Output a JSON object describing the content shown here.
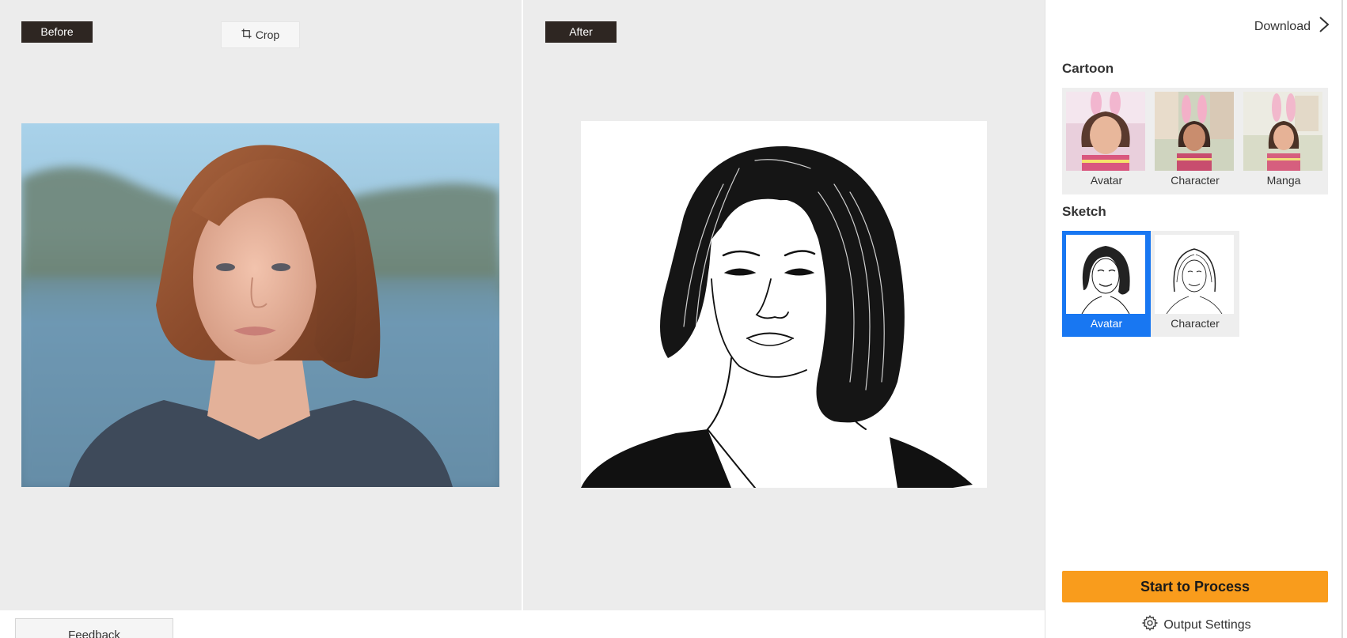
{
  "before_pane": {
    "tag": "Before",
    "crop_label": "Crop"
  },
  "after_pane": {
    "tag": "After"
  },
  "sidebar": {
    "download_label": "Download",
    "cartoon": {
      "title": "Cartoon",
      "items": [
        {
          "label": "Avatar"
        },
        {
          "label": "Character"
        },
        {
          "label": "Manga"
        }
      ]
    },
    "sketch": {
      "title": "Sketch",
      "items": [
        {
          "label": "Avatar",
          "selected": true
        },
        {
          "label": "Character",
          "selected": false
        }
      ]
    },
    "start_label": "Start to Process",
    "output_settings_label": "Output Settings"
  },
  "feedback_label": "Feedback",
  "colors": {
    "accent_orange": "#f99c1c",
    "selected_blue": "#1877f2",
    "tag_dark": "#2e2622",
    "pane_bg": "#ececec"
  },
  "icons": [
    "crop-icon",
    "chevron-right-icon",
    "gear-icon"
  ]
}
